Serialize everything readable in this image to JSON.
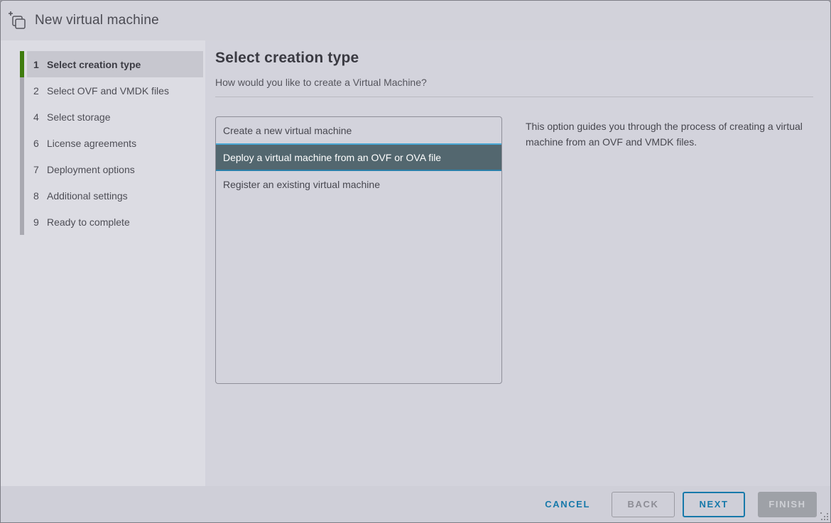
{
  "window": {
    "title": "New virtual machine"
  },
  "page": {
    "title": "Select creation type",
    "subtitle": "How would you like to create a Virtual Machine?"
  },
  "sidebar": {
    "steps": [
      {
        "num": "1",
        "label": "Select creation type",
        "active": true
      },
      {
        "num": "2",
        "label": "Select OVF and VMDK files",
        "active": false
      },
      {
        "num": "4",
        "label": "Select storage",
        "active": false
      },
      {
        "num": "6",
        "label": "License agreements",
        "active": false
      },
      {
        "num": "7",
        "label": "Deployment options",
        "active": false
      },
      {
        "num": "8",
        "label": "Additional settings",
        "active": false
      },
      {
        "num": "9",
        "label": "Ready to complete",
        "active": false
      }
    ]
  },
  "creation_options": {
    "items": [
      {
        "label": "Create a new virtual machine",
        "selected": false
      },
      {
        "label": "Deploy a virtual machine from an OVF or OVA file",
        "selected": true
      },
      {
        "label": "Register an existing virtual machine",
        "selected": false
      }
    ],
    "description": "This option guides you through the process of creating a virtual machine from an OVF and VMDK files."
  },
  "footer": {
    "cancel_label": "CANCEL",
    "back_label": "BACK",
    "next_label": "NEXT",
    "finish_label": "FINISH"
  },
  "icons": {
    "header_icon": "new-vm-icon",
    "resize_grip": "resize-grip-icon"
  },
  "colors": {
    "accent_blue": "#1779aa",
    "selection_bg": "#53676f",
    "selection_border_top": "#49a8d5",
    "selection_border_bottom": "#2a7fa8",
    "active_step_green": "#3f7c0e",
    "header_bg": "#d2d2da",
    "sidebar_bg": "#dcdce3",
    "main_bg": "#d3d3dc",
    "footer_bg": "#cfcfd8"
  }
}
